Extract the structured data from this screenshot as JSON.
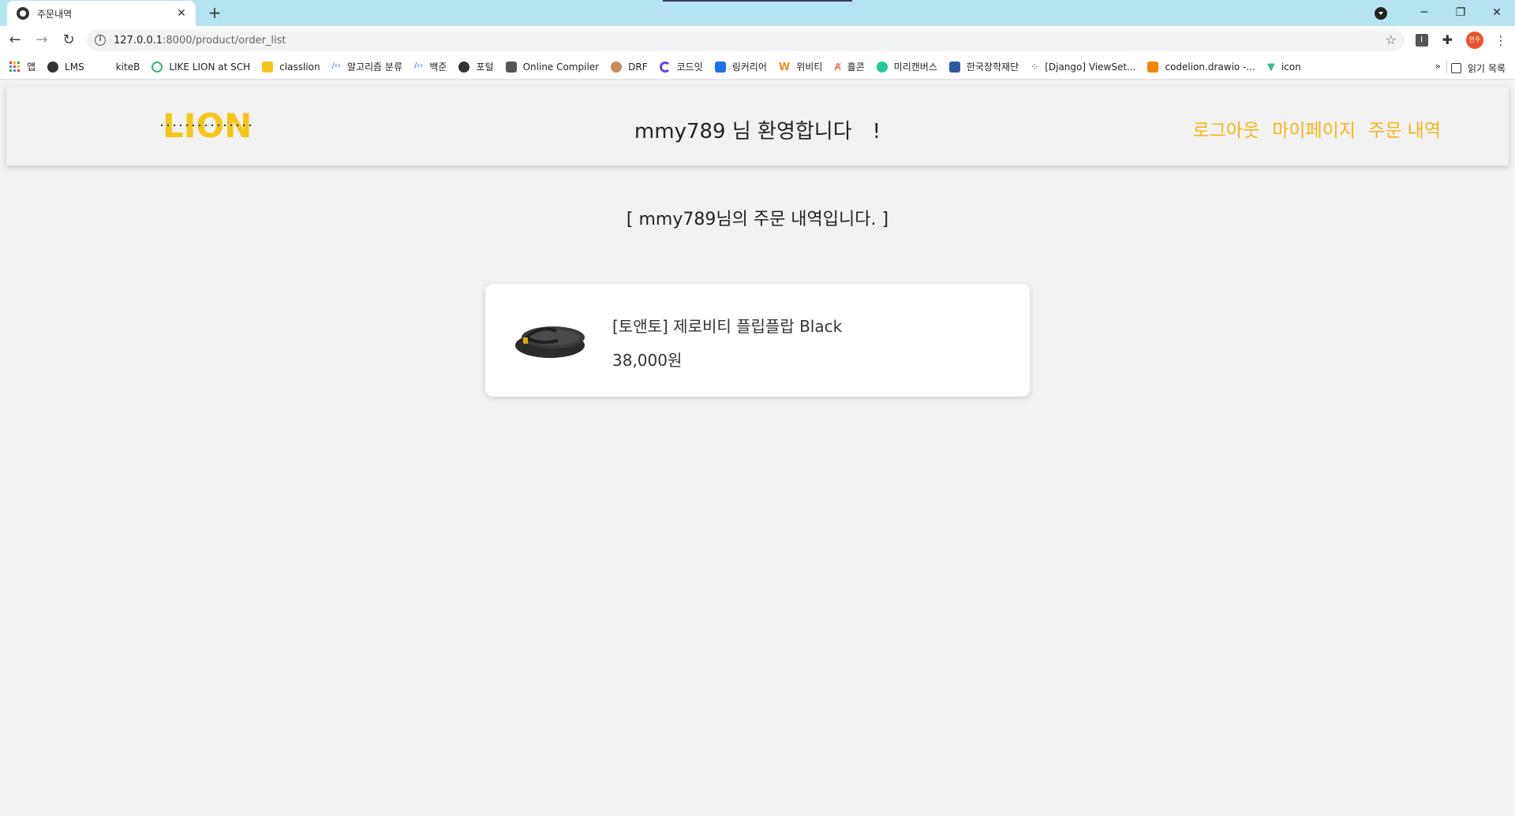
{
  "browser": {
    "tab_title": "주문내역",
    "url_host": "127.0.0.1",
    "url_path": ":8000/product/order_list",
    "avatar_label": "연주",
    "bookmarks": [
      {
        "label": "앱",
        "icon": "apps-icon"
      },
      {
        "label": "LMS",
        "icon": "globe-icon"
      },
      {
        "label": "kiteB",
        "icon": "blank-icon"
      },
      {
        "label": "LIKE LION at SCH",
        "icon": "circle-icon"
      },
      {
        "label": "classlion",
        "icon": "lion-icon"
      },
      {
        "label": "알고리즘 분류",
        "icon": "code-icon"
      },
      {
        "label": "백준",
        "icon": "code-icon"
      },
      {
        "label": "포털",
        "icon": "globe-icon"
      },
      {
        "label": "Online Compiler",
        "icon": "compiler-icon"
      },
      {
        "label": "DRF",
        "icon": "face-icon"
      },
      {
        "label": "코드잇",
        "icon": "codeit-icon"
      },
      {
        "label": "링커리어",
        "icon": "linkareer-icon"
      },
      {
        "label": "위비티",
        "icon": "wevity-icon"
      },
      {
        "label": "흘콘",
        "icon": "a-icon"
      },
      {
        "label": "미리캔버스",
        "icon": "m-icon"
      },
      {
        "label": "한국장학재단",
        "icon": "cap-icon"
      },
      {
        "label": "[Django] ViewSet...",
        "icon": "t-icon"
      },
      {
        "label": "codelion.drawio -...",
        "icon": "drawio-icon"
      },
      {
        "label": "icon",
        "icon": "vue-icon"
      }
    ],
    "reading_list": "읽기 목록",
    "more": "»"
  },
  "site": {
    "logo_text": "LION",
    "welcome": "mmy789 님 환영합니다",
    "welcome_mark": "!",
    "nav": {
      "logout": "로그아웃",
      "mypage": "마이페이지",
      "orders": "주문 내역"
    }
  },
  "orders": {
    "title": "[ mmy789님의 주문 내역입니다. ]",
    "items": [
      {
        "name": "[토앤토] 제로비티 플립플랍 Black",
        "price": "38,000원"
      }
    ]
  },
  "colors": {
    "accent": "#f5b71a",
    "logo": "#f5c518",
    "tabstrip": "#b5e3f0"
  }
}
